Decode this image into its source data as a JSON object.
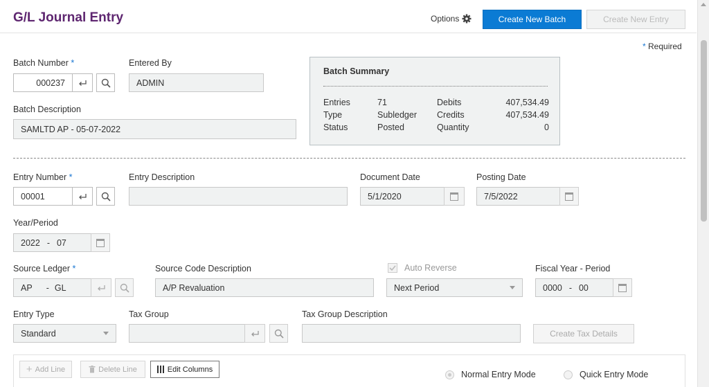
{
  "header": {
    "title": "G/L Journal Entry",
    "options_label": "Options",
    "create_batch_label": "Create New Batch",
    "create_entry_label": "Create New Entry"
  },
  "required_note": "Required",
  "batch": {
    "number_label": "Batch Number",
    "number_value": "000237",
    "entered_by_label": "Entered By",
    "entered_by_value": "ADMIN",
    "description_label": "Batch Description",
    "description_value": "SAMLTD AP - 05-07-2022"
  },
  "summary": {
    "title": "Batch Summary",
    "rows": [
      {
        "k1": "Entries",
        "v1": "71",
        "k2": "Debits",
        "v2": "407,534.49"
      },
      {
        "k1": "Type",
        "v1": "Subledger",
        "k2": "Credits",
        "v2": "407,534.49"
      },
      {
        "k1": "Status",
        "v1": "Posted",
        "k2": "Quantity",
        "v2": "0"
      }
    ]
  },
  "entry": {
    "number_label": "Entry Number",
    "number_value": "00001",
    "description_label": "Entry Description",
    "description_value": "",
    "document_date_label": "Document Date",
    "document_date_value": "5/1/2020",
    "posting_date_label": "Posting Date",
    "posting_date_value": "7/5/2022",
    "year_period_label": "Year/Period",
    "year_value": "2022",
    "period_value": "07",
    "source_ledger_label": "Source Ledger",
    "ledger_value": "AP",
    "ledger_type_value": "GL",
    "source_code_desc_label": "Source Code Description",
    "source_code_desc_value": "A/P Revaluation",
    "auto_reverse_label": "Auto Reverse",
    "reverse_select_value": "Next Period",
    "fiscal_label": "Fiscal Year - Period",
    "fiscal_year_value": "0000",
    "fiscal_period_value": "00",
    "entry_type_label": "Entry Type",
    "entry_type_value": "Standard",
    "tax_group_label": "Tax Group",
    "tax_group_value": "",
    "tax_group_desc_label": "Tax Group Description",
    "tax_group_desc_value": "",
    "create_tax_label": "Create Tax Details"
  },
  "grid_toolbar": {
    "add_line_label": "Add Line",
    "delete_line_label": "Delete Line",
    "edit_columns_label": "Edit Columns",
    "normal_mode_label": "Normal Entry Mode",
    "quick_mode_label": "Quick Entry Mode"
  },
  "colors": {
    "title": "#5e2670",
    "primary": "#0b7bd4",
    "required": "#1976d2"
  }
}
